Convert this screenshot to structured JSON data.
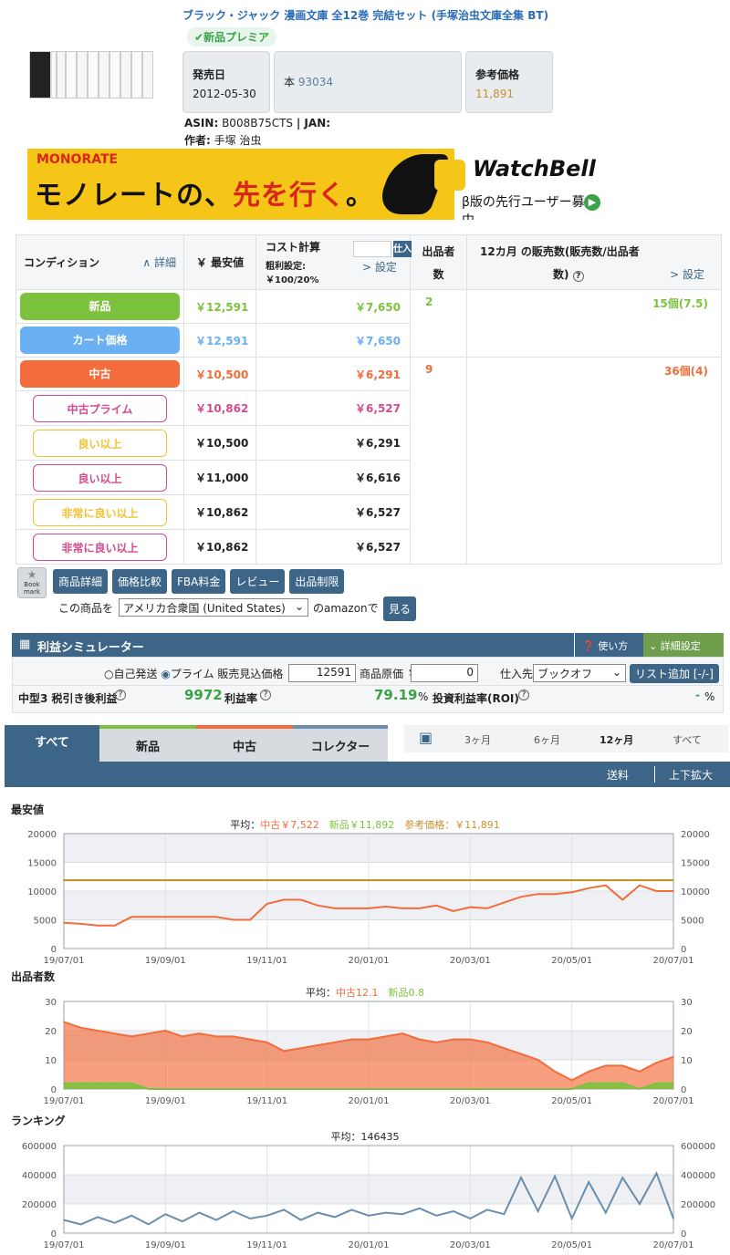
{
  "product": {
    "title": "ブラック・ジャック 漫画文庫 全12巻 完結セット (手塚治虫文庫全集 BT)",
    "badge": "✔新品プレミア",
    "release_label": "発売日",
    "release_value": "2012-05-30",
    "category_label": "本",
    "category_value": "93034",
    "ref_price_label": "参考価格",
    "ref_price_value": "11,891",
    "asin_label": "ASIN:",
    "asin_value": "B008B75CTS",
    "jan_label": "| JAN:",
    "author_label": "作者:",
    "author_value": "手塚 治虫"
  },
  "banner": {
    "logo": "MONORATE",
    "copy_a": "モノレートの、",
    "copy_b": "先を行く",
    "copy_c": "。",
    "brand": "WatchBell",
    "sub": "β版の先行ユーザー募集中"
  },
  "table": {
    "h_condition": "コンディション",
    "h_detail": "∧ 詳細",
    "h_min": "￥ 最安値",
    "h_cost": "コスト計算",
    "h_cost_sub": "粗利設定:",
    "h_cost_sub2": "￥100/20%",
    "h_cost_input_btn": "仕入",
    "h_cost_setting": "> 設定",
    "h_sellers_a": "出品者",
    "h_sellers_b": "数",
    "h_sales_a": "12カ月 の販売数(販売数/出品者",
    "h_sales_b": "数)",
    "h_sales_setting": "> 設定",
    "rows": [
      {
        "label": "新品",
        "min": "￥12,591",
        "cost": "￥7,650"
      },
      {
        "label": "カート価格",
        "min": "￥12,591",
        "cost": "￥7,650"
      },
      {
        "label": "中古",
        "min": "￥10,500",
        "cost": "￥6,291"
      },
      {
        "label": "中古プライム",
        "min": "￥10,862",
        "cost": "￥6,527"
      },
      {
        "label": "良い以上",
        "min": "￥10,500",
        "cost": "￥6,291"
      },
      {
        "label": "良い以上",
        "min": "￥11,000",
        "cost": "￥6,616"
      },
      {
        "label": "非常に良い以上",
        "min": "￥10,862",
        "cost": "￥6,527"
      },
      {
        "label": "非常に良い以上",
        "min": "￥10,862",
        "cost": "￥6,527"
      }
    ],
    "new_sellers": "2",
    "new_sales": "15個(7.5)",
    "used_sellers": "9",
    "used_sales": "36個(4)"
  },
  "links": {
    "bookmark": "Book mark",
    "detail": "商品詳細",
    "compare": "価格比較",
    "fba": "FBA料金",
    "review": "レビュー",
    "restrict": "出品制限",
    "country_prefix": "この商品を",
    "country": "アメリカ合衆国 (United States)",
    "country_suffix": "のamazonで",
    "view": "見る"
  },
  "sim": {
    "title": "利益シミュレーター",
    "howto": "使い方",
    "detail": "詳細設定",
    "opt_self": "自己発送",
    "opt_prime": "プライム",
    "price_label": "販売見込価格 ￥",
    "price_value": "12591",
    "cost_label": "商品原価 ￥",
    "cost_value": "0",
    "supplier_label": "仕入先",
    "supplier_value": "ブックオフ",
    "list_add": "リスト追加 [-/-]",
    "profit_label": "中型3 税引き後利益",
    "profit_value": "9972",
    "rate_label": "利益率",
    "rate_value": "79.19",
    "rate_unit": "%",
    "roi_label": "投資利益率(ROI)",
    "roi_value": "-",
    "roi_unit": "%"
  },
  "tabs": {
    "all": "すべて",
    "new": "新品",
    "used": "中古",
    "collector": "コレクター",
    "p3": "3ヶ月",
    "p6": "6ヶ月",
    "p12": "12ヶ月",
    "pall": "すべて",
    "shipping": "送料",
    "zoom": "上下拡大"
  },
  "colors": {
    "new": "#7dc23f",
    "cart": "#6ab0f3",
    "used": "#f36c3b",
    "prime": "#d44a8c",
    "good": "#f1c232",
    "nav": "#3d6587",
    "ref": "#c8912b"
  },
  "chart_data": [
    {
      "type": "line",
      "title": "最安値",
      "legend_prefix": "平均：",
      "legend_used": "中古￥7,522",
      "legend_new": "新品￥11,892",
      "legend_ref": "参考価格：￥11,891",
      "x_ticks": [
        "19/07/01",
        "19/09/01",
        "19/11/01",
        "20/01/01",
        "20/03/01",
        "20/05/01",
        "20/07/01"
      ],
      "y_ticks": [
        "0",
        "5000",
        "10000",
        "15000",
        "20000"
      ],
      "ylim": [
        0,
        20000
      ],
      "series": [
        {
          "name": "中古",
          "values": [
            4500,
            4300,
            4000,
            4000,
            5500,
            5500,
            5500,
            5500,
            5500,
            5500,
            5000,
            5000,
            7800,
            8500,
            8500,
            7500,
            7000,
            7000,
            7000,
            7300,
            7000,
            7000,
            7500,
            6500,
            7200,
            7000,
            8000,
            9000,
            9500,
            9500,
            9800,
            10500,
            11000,
            8500,
            11000,
            10000,
            10000
          ]
        },
        {
          "name": "新品",
          "values": [
            11900,
            11900,
            11900,
            11900,
            11900,
            11900,
            11900,
            11900,
            11900,
            11900,
            11900,
            11900,
            11900,
            11900,
            11900,
            11900,
            11900,
            11900,
            11900,
            11900,
            11900,
            11900,
            11900,
            11900,
            11900,
            11900,
            11900,
            11900,
            11900,
            11900,
            11900,
            11900,
            11900,
            11900,
            11900,
            11900,
            11900
          ]
        },
        {
          "name": "参考価格",
          "values": [
            11891,
            11891,
            11891,
            11891,
            11891,
            11891,
            11891,
            11891,
            11891,
            11891,
            11891,
            11891,
            11891,
            11891,
            11891,
            11891,
            11891,
            11891,
            11891,
            11891,
            11891,
            11891,
            11891,
            11891,
            11891,
            11891,
            11891,
            11891,
            11891,
            11891,
            11891,
            11891,
            11891,
            11891,
            11891,
            11891,
            11891
          ]
        }
      ]
    },
    {
      "type": "area",
      "title": "出品者数",
      "legend_prefix": "平均：",
      "legend_used": "中古12.1",
      "legend_new": "新品0.8",
      "x_ticks": [
        "19/07/01",
        "19/09/01",
        "19/11/01",
        "20/01/01",
        "20/03/01",
        "20/05/01",
        "20/07/01"
      ],
      "y_ticks": [
        "0",
        "10",
        "20",
        "30"
      ],
      "ylim": [
        0,
        30
      ],
      "series": [
        {
          "name": "中古",
          "values": [
            23,
            21,
            20,
            19,
            18,
            19,
            20,
            18,
            19,
            18,
            18,
            17,
            16,
            13,
            14,
            15,
            16,
            17,
            17,
            18,
            19,
            17,
            16,
            17,
            17,
            16,
            14,
            12,
            10,
            6,
            3,
            6,
            8,
            8,
            6,
            9,
            11
          ]
        },
        {
          "name": "新品",
          "values": [
            2,
            2,
            2,
            2,
            2,
            0,
            0,
            0,
            0,
            0,
            0,
            0,
            0,
            0,
            0,
            0,
            0,
            0,
            0,
            0,
            0,
            0,
            0,
            0,
            0,
            0,
            0,
            0,
            0,
            0,
            0,
            2,
            2,
            2,
            0,
            2,
            2
          ]
        }
      ]
    },
    {
      "type": "line",
      "title": "ランキング",
      "legend_prefix": "平均：",
      "legend_avg": "146435",
      "x_ticks": [
        "19/07/01",
        "19/09/01",
        "19/11/01",
        "20/01/01",
        "20/03/01",
        "20/05/01",
        "20/07/01"
      ],
      "y_ticks": [
        "0",
        "200000",
        "400000",
        "600000"
      ],
      "ylim": [
        0,
        600000
      ],
      "series": [
        {
          "name": "ランキング",
          "values": [
            90000,
            60000,
            110000,
            70000,
            120000,
            60000,
            130000,
            80000,
            140000,
            90000,
            150000,
            100000,
            120000,
            160000,
            90000,
            140000,
            110000,
            160000,
            120000,
            140000,
            130000,
            170000,
            120000,
            150000,
            100000,
            160000,
            130000,
            380000,
            150000,
            390000,
            100000,
            350000,
            140000,
            380000,
            200000,
            410000,
            100000
          ]
        }
      ]
    }
  ]
}
